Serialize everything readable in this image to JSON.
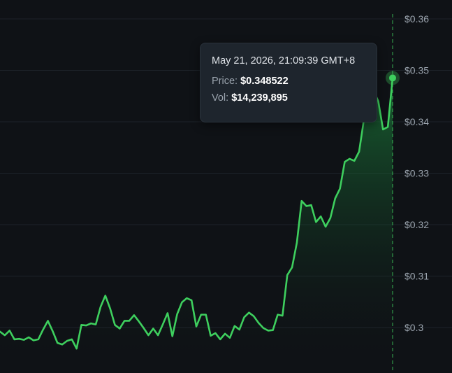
{
  "chart_data": {
    "type": "area",
    "title": "",
    "xlabel": "",
    "ylabel": "",
    "ylim": [
      0.2935,
      0.3615
    ],
    "yticks": [
      0.3,
      0.31,
      0.32,
      0.33,
      0.34,
      0.35,
      0.36
    ],
    "ytick_labels": [
      "$0.3",
      "$0.31",
      "$0.32",
      "$0.33",
      "$0.34",
      "$0.35",
      "$0.36"
    ],
    "grid": true,
    "line_color": "#3ecf5e",
    "series": [
      {
        "values": [
          0.2992,
          0.2985,
          0.2994,
          0.2977,
          0.2978,
          0.2976,
          0.2981,
          0.2975,
          0.2977,
          0.2996,
          0.3013,
          0.2993,
          0.297,
          0.2967,
          0.2974,
          0.2977,
          0.2959,
          0.3005,
          0.3004,
          0.3008,
          0.3006,
          0.304,
          0.3062,
          0.3037,
          0.3005,
          0.2998,
          0.3013,
          0.3013,
          0.3024,
          0.3012,
          0.2999,
          0.2985,
          0.2998,
          0.2985,
          0.3006,
          0.3028,
          0.2983,
          0.3026,
          0.3049,
          0.3057,
          0.3053,
          0.3002,
          0.3025,
          0.3025,
          0.2984,
          0.2989,
          0.2977,
          0.2988,
          0.298,
          0.3003,
          0.2996,
          0.302,
          0.3029,
          0.3022,
          0.3009,
          0.2999,
          0.2994,
          0.2995,
          0.3025,
          0.3023,
          0.3102,
          0.3117,
          0.3165,
          0.3246,
          0.3236,
          0.3238,
          0.3205,
          0.3216,
          0.3196,
          0.3213,
          0.3251,
          0.327,
          0.3322,
          0.3328,
          0.3324,
          0.3342,
          0.3404,
          0.3458,
          0.3461,
          0.344,
          0.3385,
          0.339,
          0.348522
        ]
      }
    ],
    "tooltip": {
      "date": "May 21, 2026, 21:09:39 GMT+8",
      "price_label": "Price:",
      "price_value": "$0.348522",
      "vol_label": "Vol:",
      "vol_value": "$14,239,895"
    }
  }
}
